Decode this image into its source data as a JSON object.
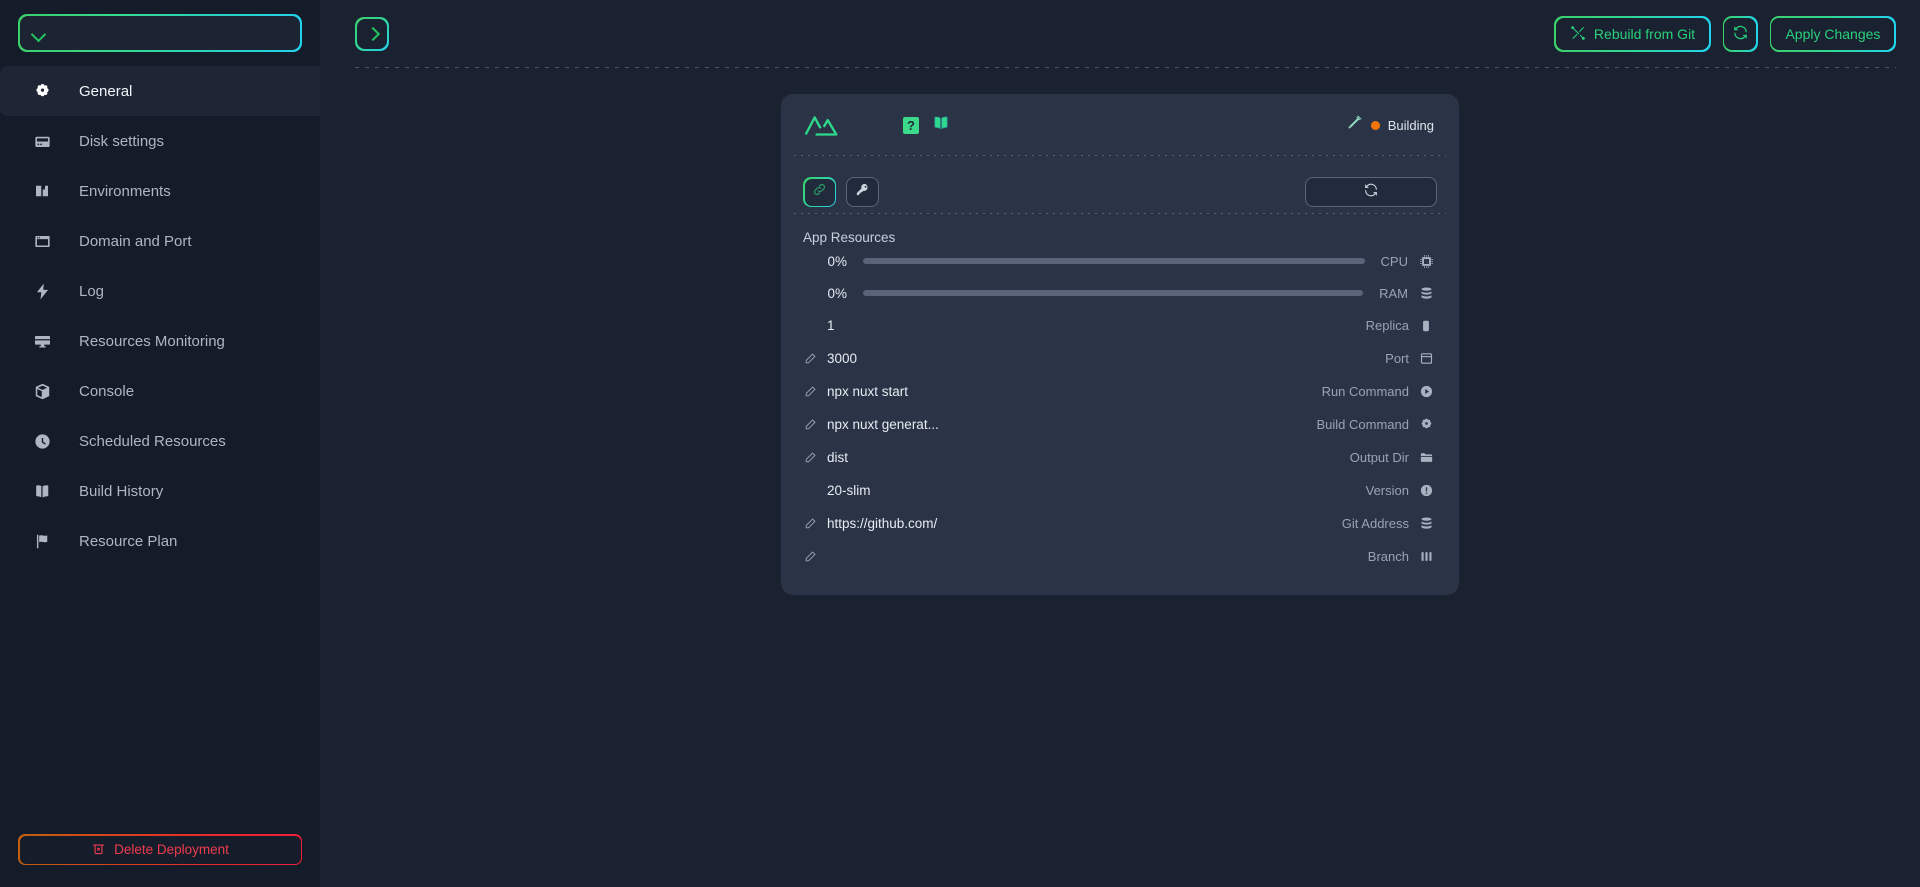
{
  "sidebar": {
    "deployment_select": {
      "value": "",
      "icon": "chevron-down-icon"
    },
    "items": [
      {
        "label": "General",
        "icon": "gear-icon",
        "active": true
      },
      {
        "label": "Disk settings",
        "icon": "hard-drive-icon",
        "active": false
      },
      {
        "label": "Environments",
        "icon": "environment-icon",
        "active": false
      },
      {
        "label": "Domain and Port",
        "icon": "browser-icon",
        "active": false
      },
      {
        "label": "Log",
        "icon": "lightning-icon",
        "active": false
      },
      {
        "label": "Resources Monitoring",
        "icon": "monitor-icon",
        "active": false
      },
      {
        "label": "Console",
        "icon": "box-icon",
        "active": false
      },
      {
        "label": "Scheduled Resources",
        "icon": "clock-icon",
        "active": false
      },
      {
        "label": "Build History",
        "icon": "book-icon",
        "active": false
      },
      {
        "label": "Resource Plan",
        "icon": "flag-icon",
        "active": false
      }
    ],
    "delete_button": {
      "label": "Delete Deployment",
      "icon": "trash-icon",
      "color": "#ef3b4e"
    }
  },
  "topbar": {
    "toggle": {
      "icon": "chevron-right-icon"
    },
    "rebuild_button": {
      "label": "Rebuild from Git",
      "icon": "tools-icon"
    },
    "refresh_button": {
      "icon": "refresh-icon"
    },
    "apply_button": {
      "label": "Apply Changes"
    },
    "accent_start": "#3ad06a",
    "accent_end": "#22d3ee"
  },
  "card": {
    "logo": "nuxt-logo",
    "help_badge": "?",
    "docs_icon": "book-icon",
    "build_icon": "hammer-icon",
    "status": {
      "text": "Building",
      "color": "#f2760a"
    },
    "actions": {
      "link_button": {
        "icon": "link-icon"
      },
      "key_button": {
        "icon": "key-icon"
      },
      "refresh_button": {
        "icon": "refresh-icon"
      }
    },
    "resources_title": "App Resources",
    "resources": [
      {
        "value": "0%",
        "label": "CPU",
        "icon": "cpu-icon",
        "percent": 0
      },
      {
        "value": "0%",
        "label": "RAM",
        "icon": "ram-icon",
        "percent": 0
      }
    ],
    "details": [
      {
        "value": "1",
        "label": "Replica",
        "icon": "replica-icon",
        "editable": false
      },
      {
        "value": "3000",
        "label": "Port",
        "icon": "port-icon",
        "editable": true
      },
      {
        "value": "npx nuxt start",
        "label": "Run Command",
        "icon": "play-icon",
        "editable": true
      },
      {
        "value": "npx nuxt generat...",
        "label": "Build Command",
        "icon": "gear-icon",
        "editable": true
      },
      {
        "value": "dist",
        "label": "Output Dir",
        "icon": "folder-icon",
        "editable": true
      },
      {
        "value": "20-slim",
        "label": "Version",
        "icon": "info-icon",
        "editable": false
      },
      {
        "value": "https://github.com/",
        "label": "Git Address",
        "icon": "server-icon",
        "editable": true
      },
      {
        "value": "",
        "label": "Branch",
        "icon": "branch-icon",
        "editable": true
      }
    ]
  }
}
